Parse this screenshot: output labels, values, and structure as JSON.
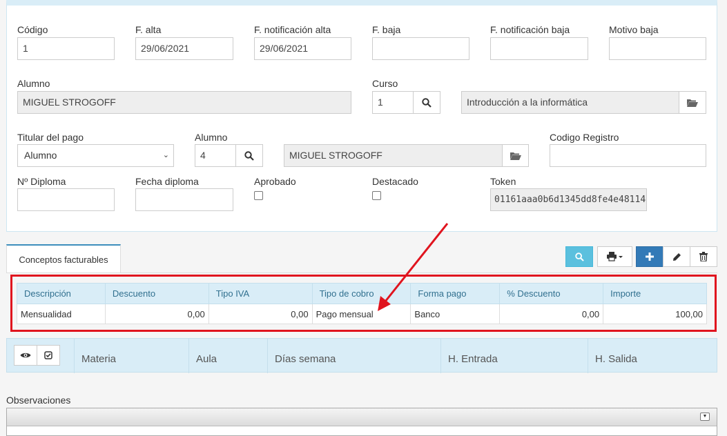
{
  "form": {
    "codigo": {
      "label": "Código",
      "value": "1"
    },
    "f_alta": {
      "label": "F. alta",
      "value": "29/06/2021"
    },
    "f_notif_alta": {
      "label": "F. notificación alta",
      "value": "29/06/2021"
    },
    "f_baja": {
      "label": "F. baja",
      "value": ""
    },
    "f_notif_baja": {
      "label": "F. notificación baja",
      "value": ""
    },
    "motivo_baja": {
      "label": "Motivo baja",
      "value": ""
    },
    "alumno": {
      "label": "Alumno",
      "value": "MIGUEL STROGOFF"
    },
    "curso": {
      "label": "Curso",
      "id": "1",
      "name": "Introducción a la informática"
    },
    "titular_pago": {
      "label": "Titular del pago",
      "value": "Alumno"
    },
    "alumno_pago": {
      "label": "Alumno",
      "id": "4",
      "name": "MIGUEL STROGOFF"
    },
    "codigo_registro": {
      "label": "Codigo Registro",
      "value": ""
    },
    "n_diploma": {
      "label": "Nº Diploma",
      "value": ""
    },
    "fecha_diploma": {
      "label": "Fecha diploma",
      "value": ""
    },
    "aprobado": {
      "label": "Aprobado",
      "checked": false
    },
    "destacado": {
      "label": "Destacado",
      "checked": false
    },
    "token": {
      "label": "Token",
      "value": "01161aaa0b6d1345dd8fe4e48114"
    }
  },
  "tabs": [
    {
      "label": "Conceptos facturables"
    }
  ],
  "toolbar": {
    "icons": [
      "search-icon",
      "print-icon",
      "plus-icon",
      "pencil-icon",
      "trash-icon"
    ]
  },
  "conceptos": {
    "headers": [
      "Descripción",
      "Descuento",
      "Tipo IVA",
      "Tipo de cobro",
      "Forma pago",
      "% Descuento",
      "Importe"
    ],
    "rows": [
      [
        "Mensualidad",
        "0,00",
        "0,00",
        "Pago mensual",
        "Banco",
        "0,00",
        "100,00"
      ]
    ]
  },
  "horario": {
    "headers": [
      "Materia",
      "Aula",
      "Días semana",
      "H. Entrada",
      "H. Salida"
    ]
  },
  "observaciones": {
    "label": "Observaciones"
  },
  "colors": {
    "accent": "#337ab7",
    "header_bg": "#d9edf7",
    "highlight": "#e0141e"
  }
}
